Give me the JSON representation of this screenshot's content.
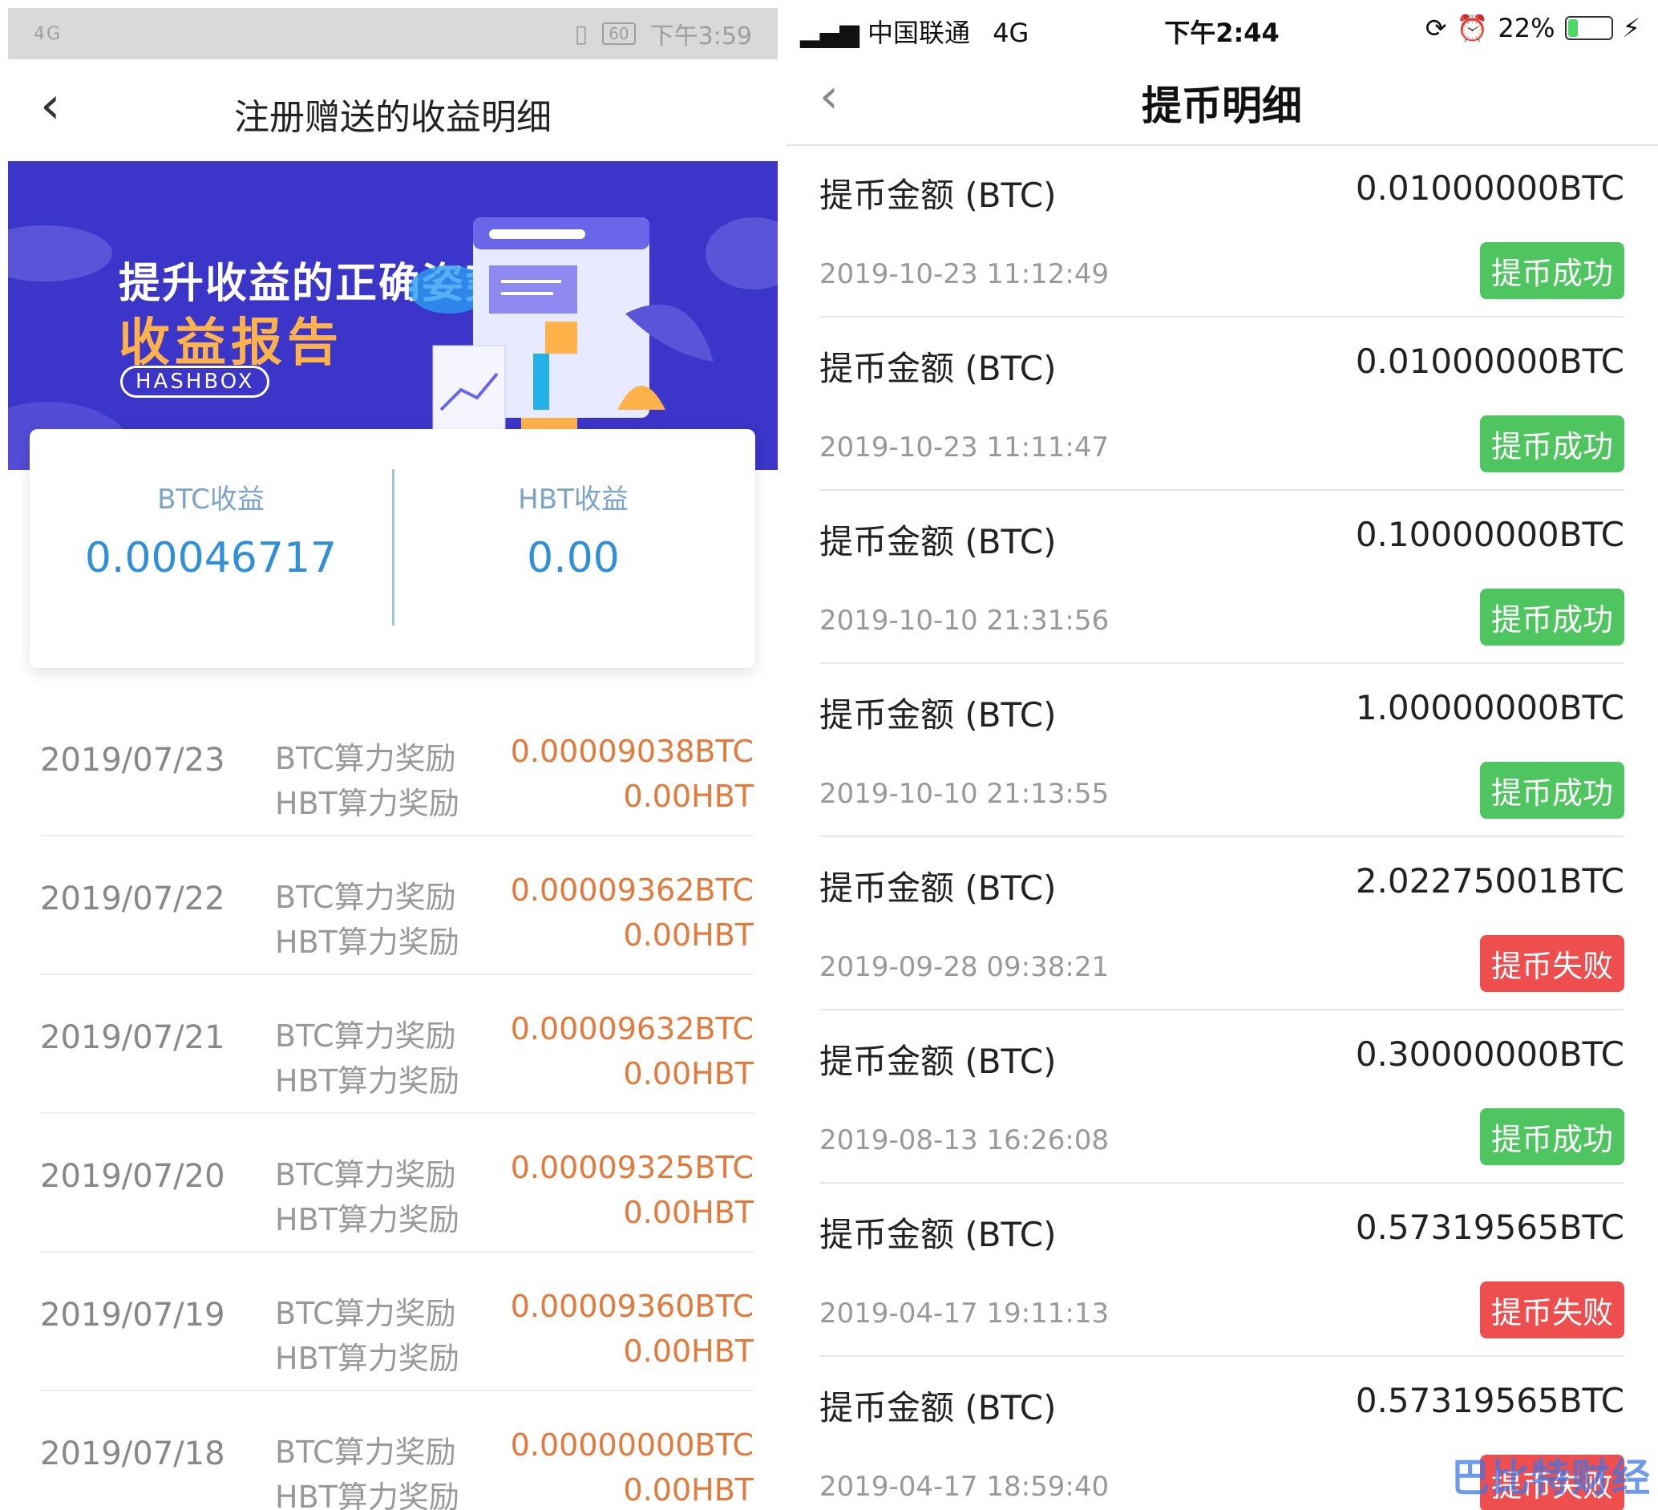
{
  "left": {
    "status_bar": {
      "signal": "4G",
      "battery": "60",
      "time": "下午3:59"
    },
    "nav": {
      "title": "注册赠送的收益明细"
    },
    "banner": {
      "slogan": "提升收益的正确姿势",
      "report": "收益报告",
      "brand": "HASHBOX"
    },
    "summary": {
      "btc_label": "BTC收益",
      "btc_value": "0.00046717",
      "hbt_label": "HBT收益",
      "hbt_value": "0.00"
    },
    "rows": [
      {
        "date": "2019/07/23",
        "label1": "BTC算力奖励",
        "value1": "0.00009038BTC",
        "label2": "HBT算力奖励",
        "value2": "0.00HBT"
      },
      {
        "date": "2019/07/22",
        "label1": "BTC算力奖励",
        "value1": "0.00009362BTC",
        "label2": "HBT算力奖励",
        "value2": "0.00HBT"
      },
      {
        "date": "2019/07/21",
        "label1": "BTC算力奖励",
        "value1": "0.00009632BTC",
        "label2": "HBT算力奖励",
        "value2": "0.00HBT"
      },
      {
        "date": "2019/07/20",
        "label1": "BTC算力奖励",
        "value1": "0.00009325BTC",
        "label2": "HBT算力奖励",
        "value2": "0.00HBT"
      },
      {
        "date": "2019/07/19",
        "label1": "BTC算力奖励",
        "value1": "0.00009360BTC",
        "label2": "HBT算力奖励",
        "value2": "0.00HBT"
      },
      {
        "date": "2019/07/18",
        "label1": "BTC算力奖励",
        "value1": "0.00000000BTC",
        "label2": "HBT算力奖励",
        "value2": "0.00HBT"
      }
    ]
  },
  "right": {
    "status_bar": {
      "carrier": "中国联通",
      "network": "4G",
      "time": "下午2:44",
      "battery_percent": "22%",
      "battery_level": 0.22
    },
    "nav": {
      "title": "提币明细"
    },
    "withdrawals": [
      {
        "label": "提币金额 (BTC)",
        "amount": "0.01000000BTC",
        "time": "2019-10-23 11:12:49",
        "status": "提币成功",
        "status_color": "#4fc55f"
      },
      {
        "label": "提币金额 (BTC)",
        "amount": "0.01000000BTC",
        "time": "2019-10-23 11:11:47",
        "status": "提币成功",
        "status_color": "#4fc55f"
      },
      {
        "label": "提币金额 (BTC)",
        "amount": "0.10000000BTC",
        "time": "2019-10-10 21:31:56",
        "status": "提币成功",
        "status_color": "#4fc55f"
      },
      {
        "label": "提币金额 (BTC)",
        "amount": "1.00000000BTC",
        "time": "2019-10-10 21:13:55",
        "status": "提币成功",
        "status_color": "#4fc55f"
      },
      {
        "label": "提币金额 (BTC)",
        "amount": "2.02275001BTC",
        "time": "2019-09-28 09:38:21",
        "status": "提币失败",
        "status_color": "#ef4e4e"
      },
      {
        "label": "提币金额 (BTC)",
        "amount": "0.30000000BTC",
        "time": "2019-08-13 16:26:08",
        "status": "提币成功",
        "status_color": "#4fc55f"
      },
      {
        "label": "提币金额 (BTC)",
        "amount": "0.57319565BTC",
        "time": "2019-04-17 19:11:13",
        "status": "提币失败",
        "status_color": "#ef4e4e"
      },
      {
        "label": "提币金额 (BTC)",
        "amount": "0.57319565BTC",
        "time": "2019-04-17 18:59:40",
        "status": "提币失败",
        "status_color": "#ef4e4e"
      }
    ],
    "watermark": "巴比特财经"
  }
}
